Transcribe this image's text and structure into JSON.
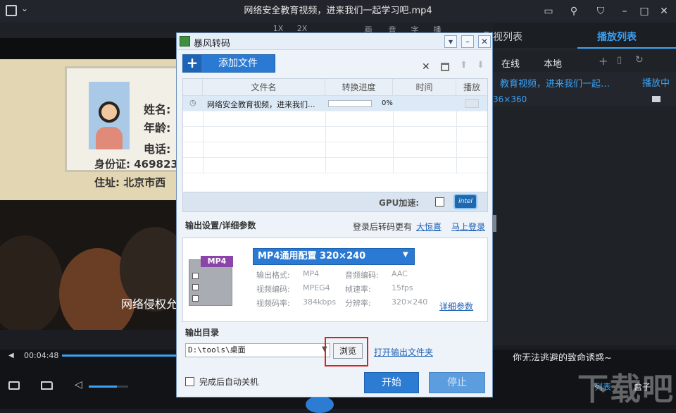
{
  "window": {
    "title": "网络安全教育视频，进来我们一起学习吧.mp4"
  },
  "toolbar": {
    "items": [
      "1X",
      "2X",
      "画",
      "音",
      "字",
      "播"
    ]
  },
  "video": {
    "card_name": "姓名:",
    "card_age": "年龄:",
    "card_phone": "电话:",
    "card_id": "身份证: 469823",
    "card_addr": "住址: 北京市西",
    "subtitle": "网络侵权允"
  },
  "right_panel": {
    "tab_video_list": "影视列表",
    "tab_play_list": "播放列表",
    "sub_online": "在线",
    "sub_local": "本地",
    "item_title": "教育视频，进来我们一起…",
    "item_status": "播放中",
    "item_res": "36×360",
    "now_playing_text": "你无法逃避的致命诱惑~"
  },
  "player": {
    "time": "00:04:48",
    "list_label": "列表",
    "box_label": "盒子",
    "watermark": "下载吧"
  },
  "dialog": {
    "title": "暴风转码",
    "add_file": "添加文件",
    "table": {
      "headers": [
        "文件名",
        "转换进度",
        "时间",
        "播放"
      ],
      "rows": [
        {
          "name": "网络安全教育视频，进来我们...",
          "progress": "0%",
          "progress_value": 0
        }
      ]
    },
    "gpu_label": "GPU加速:",
    "gpu_badge": "intel",
    "settings_title": "输出设置/详细参数",
    "promo_text": "登录后转码更有",
    "promo_link": "大惊喜",
    "login_link": "马上登录",
    "format_badge": "MP4",
    "preset": "MP4通用配置  320×240",
    "params": {
      "fmt_label": "输出格式:",
      "fmt_val": "MP4",
      "aenc_label": "音频编码:",
      "aenc_val": "AAC",
      "venc_label": "视频编码:",
      "venc_val": "MPEG4",
      "fps_label": "帧速率:",
      "fps_val": "15fps",
      "vbr_label": "视频码率:",
      "vbr_val": "384kbps",
      "res_label": "分辨率:",
      "res_val": "320×240"
    },
    "detail_link": "详细参数",
    "out_dir_label": "输出目录",
    "out_dir_value": "D:\\tools\\桌面",
    "browse": "浏览",
    "open_folder": "打开输出文件夹",
    "auto_shutdown": "完成后自动关机",
    "start": "开始",
    "stop": "停止"
  },
  "colors": {
    "accent": "#2a7ad4",
    "highlight": "#e02020",
    "link": "#1b5fb3"
  }
}
